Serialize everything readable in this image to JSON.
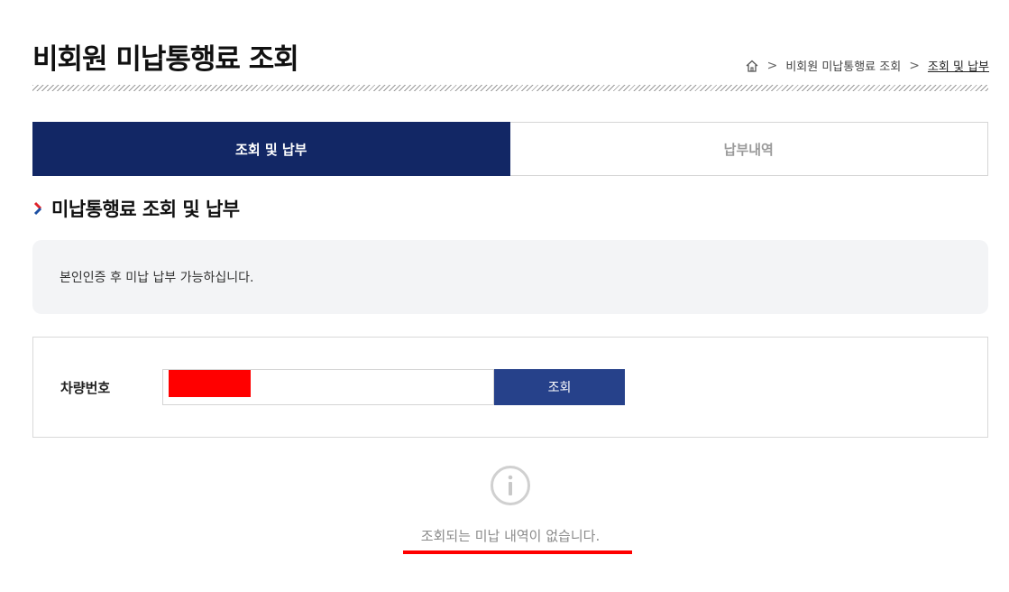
{
  "header": {
    "title": "비회원 미납통행료 조회",
    "breadcrumb": [
      "비회원 미납통행료 조회",
      "조회 및 납부"
    ]
  },
  "tabs": [
    {
      "label": "조회 및 납부",
      "active": true
    },
    {
      "label": "납부내역",
      "active": false
    }
  ],
  "section": {
    "title": "미납통행료 조회 및 납부"
  },
  "notice": {
    "text": "본인인증 후 미납 납부 가능하십니다."
  },
  "search": {
    "label": "차량번호",
    "input_value": "",
    "button_label": "조회"
  },
  "result": {
    "empty_message": "조회되는 미납 내역이 없습니다."
  },
  "colors": {
    "active_tab": "#122765",
    "search_button": "#26418a",
    "notice_bg": "#f3f4f6",
    "chevron_red": "#e0242b",
    "chevron_blue": "#1c4fa3"
  },
  "icons": [
    "home-icon",
    "chevron-right-icon",
    "section-chevron-icon",
    "info-icon"
  ]
}
